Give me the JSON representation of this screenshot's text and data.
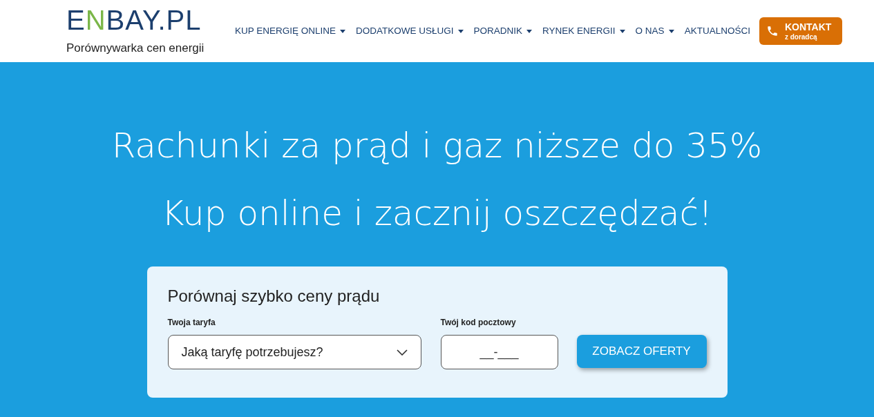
{
  "logo": {
    "parts": [
      {
        "text": "E",
        "color": "#1c3f6e"
      },
      {
        "text": "N",
        "color": "#7ab648"
      },
      {
        "text": "BAY.PL",
        "color": "#1c3f6e"
      }
    ],
    "tagline": "Porównywarka cen energii"
  },
  "nav": [
    {
      "label": "KUP ENERGIĘ ONLINE",
      "has_menu": true
    },
    {
      "label": "DODATKOWE USŁUGI",
      "has_menu": true
    },
    {
      "label": "PORADNIK",
      "has_menu": true
    },
    {
      "label": "RYNEK ENERGII",
      "has_menu": true
    },
    {
      "label": "O NAS",
      "has_menu": true
    },
    {
      "label": "AKTUALNOŚCI",
      "has_menu": false
    }
  ],
  "contact_button": {
    "label": "KONTAKT",
    "sublabel": "z doradcą"
  },
  "hero": {
    "lines": [
      "Rachunki za prąd i gaz niższe do 35%",
      "Kup online i zacznij oszczędzać!"
    ]
  },
  "form": {
    "title": "Porównaj szybko ceny prądu",
    "tariff": {
      "label": "Twoja taryfa",
      "value": "Jaką taryfę potrzebujesz?"
    },
    "postal_code": {
      "label": "Twój kod pocztowy",
      "placeholder": "__-___"
    },
    "submit": "ZOBACZ OFERTY"
  }
}
